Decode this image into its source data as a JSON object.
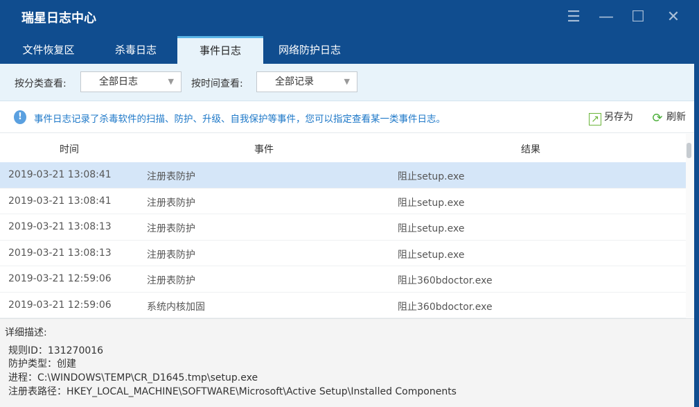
{
  "window": {
    "title": "瑞星日志中心"
  },
  "tabs": [
    {
      "label": "文件恢复区"
    },
    {
      "label": "杀毒日志"
    },
    {
      "label": "事件日志",
      "active": true
    },
    {
      "label": "网络防护日志"
    }
  ],
  "filter": {
    "category_label": "按分类查看:",
    "category_value": "全部日志",
    "time_label": "按时间查看:",
    "time_value": "全部记录"
  },
  "info": {
    "text": "事件日志记录了杀毒软件的扫描、防护、升级、自我保护等事件，您可以指定查看某一类事件日志。",
    "save_as": "另存为",
    "refresh": "刷新"
  },
  "table": {
    "headers": {
      "time": "时间",
      "event": "事件",
      "result": "结果"
    },
    "rows": [
      {
        "time": "2019-03-21 13:08:41",
        "event": "注册表防护",
        "result": "阻止setup.exe"
      },
      {
        "time": "2019-03-21 13:08:41",
        "event": "注册表防护",
        "result": "阻止setup.exe"
      },
      {
        "time": "2019-03-21 13:08:13",
        "event": "注册表防护",
        "result": "阻止setup.exe"
      },
      {
        "time": "2019-03-21 13:08:13",
        "event": "注册表防护",
        "result": "阻止setup.exe"
      },
      {
        "time": "2019-03-21 12:59:06",
        "event": "注册表防护",
        "result": "阻止360bdoctor.exe"
      },
      {
        "time": "2019-03-21 12:59:06",
        "event": "系统内核加固",
        "result": "阻止360bdoctor.exe"
      }
    ]
  },
  "detail": {
    "heading": "详细描述:",
    "lines": [
      "规则ID：131270016",
      "防护类型：创建",
      "进程：C:\\WINDOWS\\TEMP\\CR_D1645.tmp\\setup.exe",
      "注册表路径：HKEY_LOCAL_MACHINE\\SOFTWARE\\Microsoft\\Active Setup\\Installed Components"
    ]
  }
}
